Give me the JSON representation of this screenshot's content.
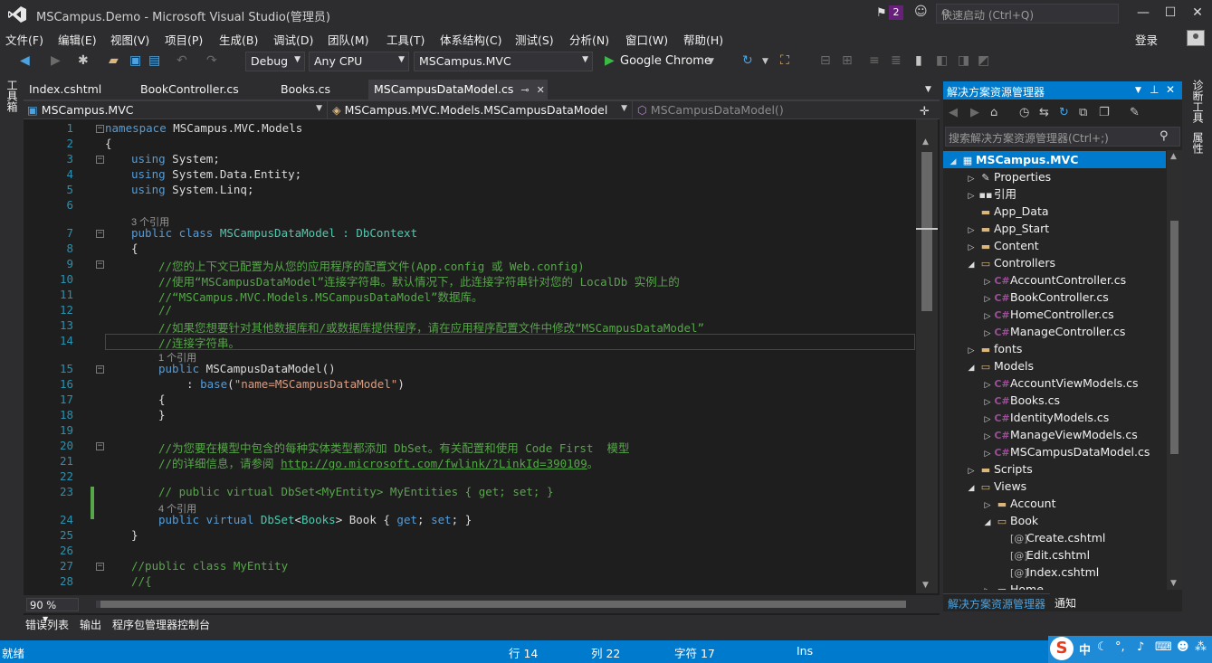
{
  "window": {
    "title": "MSCampus.Demo - Microsoft Visual Studio(管理员)",
    "notif_count": "2",
    "quick_launch_placeholder": "快速启动 (Ctrl+Q)"
  },
  "menu": [
    "文件(F)",
    "编辑(E)",
    "视图(V)",
    "项目(P)",
    "生成(B)",
    "调试(D)",
    "团队(M)",
    "工具(T)",
    "体系结构(C)",
    "测试(S)",
    "分析(N)",
    "窗口(W)",
    "帮助(H)"
  ],
  "login": "登录",
  "toolbar": {
    "config": "Debug",
    "platform": "Any CPU",
    "startup_project": "MSCampus.MVC",
    "run_target": "Google Chrome"
  },
  "left_side_tab": "工具箱",
  "right_side_tabs": [
    "诊断工具",
    "属性"
  ],
  "doc_tabs": [
    "Index.cshtml",
    "BookController.cs",
    "Books.cs",
    "MSCampusDataModel.cs"
  ],
  "nav": {
    "project": "MSCampus.MVC",
    "type": "MSCampus.MVC.Models.MSCampusDataModel",
    "member": "MSCampusDataModel()"
  },
  "code": {
    "line_numbers": [
      "1",
      "2",
      "3",
      "4",
      "5",
      "6",
      "7",
      "8",
      "9",
      "10",
      "11",
      "12",
      "13",
      "14",
      "15",
      "16",
      "17",
      "18",
      "19",
      "20",
      "21",
      "22",
      "23",
      "24",
      "25",
      "26",
      "27",
      "28"
    ],
    "ref_3": "3 个引用",
    "ref_1": "1 个引用",
    "ref_4": "4 个引用",
    "l1_kw": "namespace",
    "l1_rest": " MSCampus.MVC.Models",
    "l2": "{",
    "l3_kw": "using",
    "l3_rest": " System;",
    "l4_kw": "using",
    "l4_rest": " System.Data.Entity;",
    "l5_kw": "using",
    "l5_rest": " System.Linq;",
    "l7_kw": "public class",
    "l7_name": " MSCampusDataModel : ",
    "l7_base": "DbContext",
    "l8": "{",
    "l9": "//您的上下文已配置为从您的应用程序的配置文件(App.config 或 Web.config)",
    "l10": "//使用“MSCampusDataModel”连接字符串。默认情况下，此连接字符串针对您的 LocalDb 实例上的",
    "l11": "//“MSCampus.MVC.Models.MSCampusDataModel”数据库。",
    "l12": "//",
    "l13": "//如果您想要针对其他数据库和/或数据库提供程序，请在应用程序配置文件中修改“MSCampusDataModel”",
    "l14": "//连接字符串。",
    "l15_kw": "public",
    "l15_rest": " MSCampusDataModel()",
    "l16_a": ": ",
    "l16_kw": "base",
    "l16_b": "(",
    "l16_str": "\"name=MSCampusDataModel\"",
    "l16_c": ")",
    "l17": "{",
    "l18": "}",
    "l20": "//为您要在模型中包含的每种实体类型都添加 DbSet。有关配置和使用 Code First  模型",
    "l21_a": "//的详细信息，请参阅 ",
    "l21_link": "http://go.microsoft.com/fwlink/?LinkId=390109",
    "l21_b": "。",
    "l23": "// public virtual DbSet<MyEntity> MyEntities { get; set; }",
    "l24_kw": "public virtual",
    "l24_t": " DbSet",
    "l24_a": "<",
    "l24_t2": "Books",
    "l24_b": "> Book { ",
    "l24_get": "get",
    "l24_c": "; ",
    "l24_set": "set",
    "l24_d": "; }",
    "l25": "}",
    "l27": "//public class MyEntity",
    "l28": "//{"
  },
  "zoom": "90 %",
  "solution_explorer": {
    "title": "解决方案资源管理器",
    "search_placeholder": "搜索解决方案资源管理器(Ctrl+;)",
    "items": [
      "MSCampus.MVC",
      "Properties",
      "引用",
      "App_Data",
      "App_Start",
      "Content",
      "Controllers",
      "AccountController.cs",
      "BookController.cs",
      "HomeController.cs",
      "ManageController.cs",
      "fonts",
      "Models",
      "AccountViewModels.cs",
      "Books.cs",
      "IdentityModels.cs",
      "ManageViewModels.cs",
      "MSCampusDataModel.cs",
      "Scripts",
      "Views",
      "Account",
      "Book",
      "Create.cshtml",
      "Edit.cshtml",
      "Index.cshtml",
      "Home"
    ],
    "bottom_tabs": [
      "解决方案资源管理器",
      "通知"
    ]
  },
  "bottom_tabs": [
    "错误列表",
    "输出",
    "程序包管理器控制台"
  ],
  "status": {
    "ready": "就绪",
    "line": "行 14",
    "col": "列 22",
    "char": "字符 17",
    "mode": "Ins"
  },
  "tray": {
    "ime_logo": "S",
    "ime_lang": "中"
  }
}
